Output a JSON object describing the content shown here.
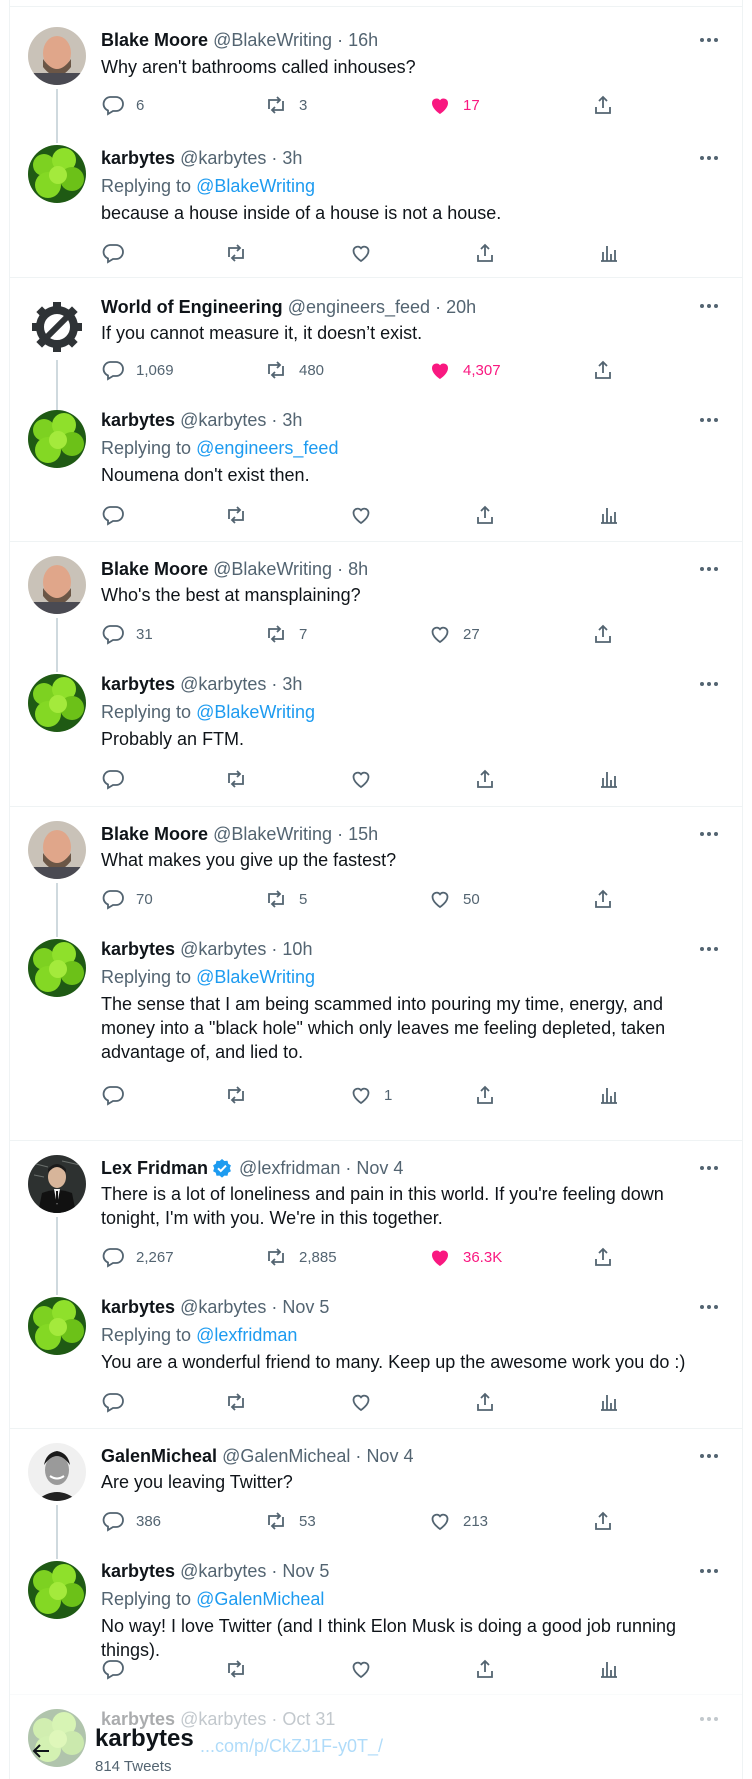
{
  "colors": {
    "accent": "#1d9bf0",
    "like": "#f91880",
    "muted": "#536471"
  },
  "threads": [
    {
      "original": {
        "name": "Blake Moore",
        "handle": "@BlakeWriting",
        "time": "16h",
        "text": "Why aren't bathrooms called inhouses?",
        "replies": "6",
        "retweets": "3",
        "likes": "17",
        "liked": true,
        "avatar": "blake-avatar"
      },
      "reply": {
        "name": "karbytes",
        "handle": "@karbytes",
        "time": "3h",
        "replying_prefix": "Replying to",
        "replying_to": "@BlakeWriting",
        "text": "because a house inside of a house is not a house."
      }
    },
    {
      "original": {
        "name": "World of Engineering",
        "handle": "@engineers_feed",
        "time": "20h",
        "text": "If you cannot measure it, it doesn’t exist.",
        "replies": "1,069",
        "retweets": "480",
        "likes": "4,307",
        "liked": true,
        "avatar": "gear-logo-avatar"
      },
      "reply": {
        "name": "karbytes",
        "handle": "@karbytes",
        "time": "3h",
        "replying_prefix": "Replying to",
        "replying_to": "@engineers_feed",
        "text": "Noumena don't exist then."
      }
    },
    {
      "original": {
        "name": "Blake Moore",
        "handle": "@BlakeWriting",
        "time": "8h",
        "text": "Who's the best at mansplaining?",
        "replies": "31",
        "retweets": "7",
        "likes": "27",
        "liked": false,
        "avatar": "blake-avatar"
      },
      "reply": {
        "name": "karbytes",
        "handle": "@karbytes",
        "time": "3h",
        "replying_prefix": "Replying to",
        "replying_to": "@BlakeWriting",
        "text": "Probably an FTM."
      }
    },
    {
      "original": {
        "name": "Blake Moore",
        "handle": "@BlakeWriting",
        "time": "15h",
        "text": "What makes you give up the fastest?",
        "replies": "70",
        "retweets": "5",
        "likes": "50",
        "liked": false,
        "avatar": "blake-avatar"
      },
      "reply": {
        "name": "karbytes",
        "handle": "@karbytes",
        "time": "10h",
        "replying_prefix": "Replying to",
        "replying_to": "@BlakeWriting",
        "text": "The sense that I am being scammed into pouring my time, energy, and money into a \"black hole\" which only leaves me feeling depleted, taken advantage of, and lied to.",
        "likes": "1"
      }
    },
    {
      "original": {
        "name": "Lex Fridman",
        "handle": "@lexfridman",
        "time": "Nov 4",
        "text": "There is a lot of loneliness and pain in this world. If you're feeling down tonight, I'm with you. We're in this together.",
        "replies": "2,267",
        "retweets": "2,885",
        "likes": "36.3K",
        "liked": true,
        "avatar": "lex-avatar",
        "verified": true
      },
      "reply": {
        "name": "karbytes",
        "handle": "@karbytes",
        "time": "Nov 5",
        "replying_prefix": "Replying to",
        "replying_to": "@lexfridman",
        "text": "You are a wonderful friend to many. Keep up the awesome work you do :)"
      }
    },
    {
      "original": {
        "name": "GalenMicheal",
        "handle": "@GalenMicheal",
        "time": "Nov 4",
        "text": "Are you leaving Twitter?",
        "replies": "386",
        "retweets": "53",
        "likes": "213",
        "liked": false,
        "avatar": "galen-avatar"
      },
      "reply": {
        "name": "karbytes",
        "handle": "@karbytes",
        "time": "Nov 5",
        "replying_prefix": "Replying to",
        "replying_to": "@GalenMicheal",
        "text": "No way! I love Twitter (and I think Elon Musk is doing a good job running things)."
      }
    }
  ],
  "partial_tweet": {
    "name": "karbytes",
    "handle": "@karbytes",
    "time": "Oct 31",
    "text": "...com/p/CkZJ1F-y0T_/"
  },
  "profile_header": {
    "name": "karbytes",
    "tweet_count": "814 Tweets"
  },
  "separator": "·"
}
